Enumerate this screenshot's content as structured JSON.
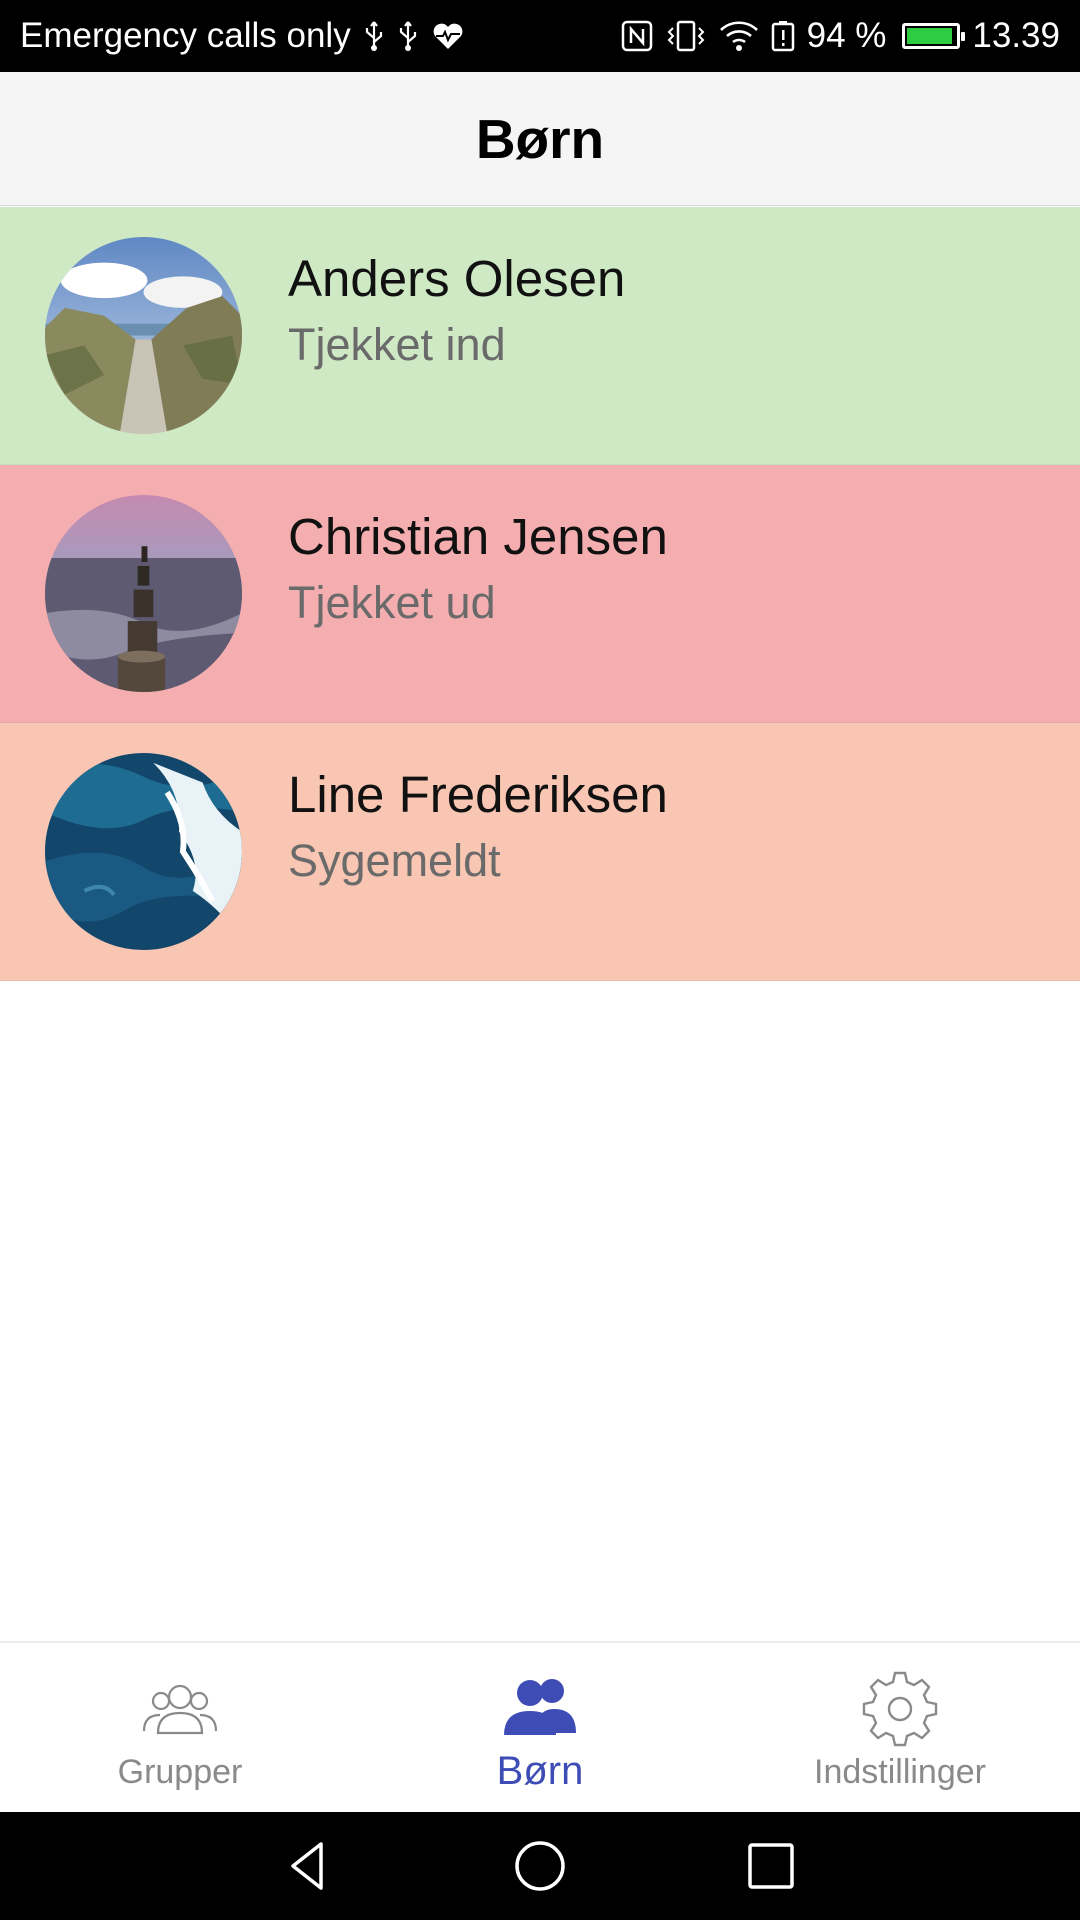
{
  "status_bar": {
    "carrier": "Emergency calls only",
    "battery_percent": "94 %",
    "battery_level": 0.94,
    "time": "13.39",
    "icons": [
      "usb-icon",
      "usb-icon",
      "heart-icon",
      "nfc-icon",
      "vibrate-icon",
      "wifi-icon",
      "battery-alert-icon",
      "battery-icon"
    ]
  },
  "header": {
    "title": "Børn"
  },
  "children": [
    {
      "name": "Anders Olesen",
      "status": "Tjekket ind",
      "color": "#cfe9c5",
      "avatar": "beach-path-photo"
    },
    {
      "name": "Christian Jensen",
      "status": "Tjekket ud",
      "color": "#f5aeb0",
      "avatar": "sea-pier-photo"
    },
    {
      "name": "Line Frederiksen",
      "status": "Sygemeldt",
      "color": "#f8c6b2",
      "avatar": "ocean-waves-photo"
    }
  ],
  "bottom_nav": {
    "tabs": [
      {
        "label": "Grupper",
        "icon": "group-icon",
        "active": false
      },
      {
        "label": "Børn",
        "icon": "children-icon",
        "active": true
      },
      {
        "label": "Indstillinger",
        "icon": "gear-icon",
        "active": false
      }
    ],
    "active_color": "#3d4db5",
    "inactive_color": "#8a8a8a"
  },
  "system_nav": {
    "buttons": [
      "back-icon",
      "home-icon",
      "recents-icon"
    ]
  }
}
